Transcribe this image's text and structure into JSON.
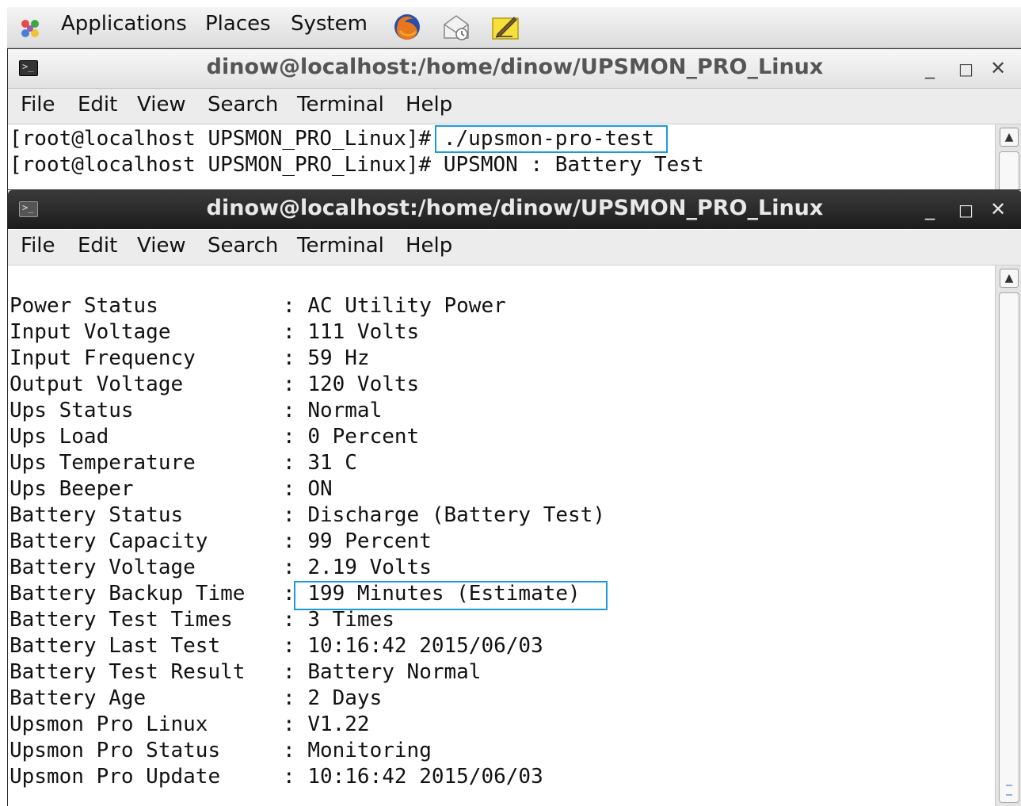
{
  "panel": {
    "applications_label": "Applications",
    "places_label": "Places",
    "system_label": "System"
  },
  "window1": {
    "title": "dinow@localhost:/home/dinow/UPSMON_PRO_Linux",
    "menu": [
      "File",
      "Edit",
      "View",
      "Search",
      "Terminal",
      "Help"
    ],
    "lines": [
      {
        "prompt": "[root@localhost UPSMON_PRO_Linux]# ",
        "command": "./upsmon-pro-test"
      },
      {
        "prompt": "[root@localhost UPSMON_PRO_Linux]# ",
        "command": "UPSMON : Battery Test"
      }
    ]
  },
  "window2": {
    "title": "dinow@localhost:/home/dinow/UPSMON_PRO_Linux",
    "menu": [
      "File",
      "Edit",
      "View",
      "Search",
      "Terminal",
      "Help"
    ],
    "rows": [
      {
        "label": "Power Status",
        "value": "AC Utility Power"
      },
      {
        "label": "Input Voltage",
        "value": "111 Volts"
      },
      {
        "label": "Input Frequency",
        "value": "59 Hz"
      },
      {
        "label": "Output Voltage",
        "value": "120 Volts"
      },
      {
        "label": "Ups Status",
        "value": "Normal"
      },
      {
        "label": "Ups Load",
        "value": "0 Percent"
      },
      {
        "label": "Ups Temperature",
        "value": "31 C"
      },
      {
        "label": "Ups Beeper",
        "value": "ON"
      },
      {
        "label": "Battery Status",
        "value": "Discharge (Battery Test)"
      },
      {
        "label": "Battery Capacity",
        "value": "99 Percent"
      },
      {
        "label": "Battery Voltage",
        "value": "2.19 Volts"
      },
      {
        "label": "Battery Backup Time",
        "value": "199 Minutes (Estimate)"
      },
      {
        "label": "Battery Test Times",
        "value": "3 Times"
      },
      {
        "label": "Battery Last Test",
        "value": "10:16:42 2015/06/03"
      },
      {
        "label": "Battery Test Result",
        "value": "Battery Normal"
      },
      {
        "label": "Battery Age",
        "value": "2 Days"
      },
      {
        "label": "Upsmon Pro Linux",
        "value": "V1.22"
      },
      {
        "label": "Upsmon Pro Status",
        "value": "Monitoring"
      },
      {
        "label": "Upsmon Pro Update",
        "value": "10:16:42 2015/06/03"
      }
    ]
  },
  "colors": {
    "highlight": "#1c9ae0",
    "terminal_bg": "#ffffff",
    "active_titlebar": "#1c1c1c",
    "inactive_titlebar": "#e2e2e2"
  }
}
